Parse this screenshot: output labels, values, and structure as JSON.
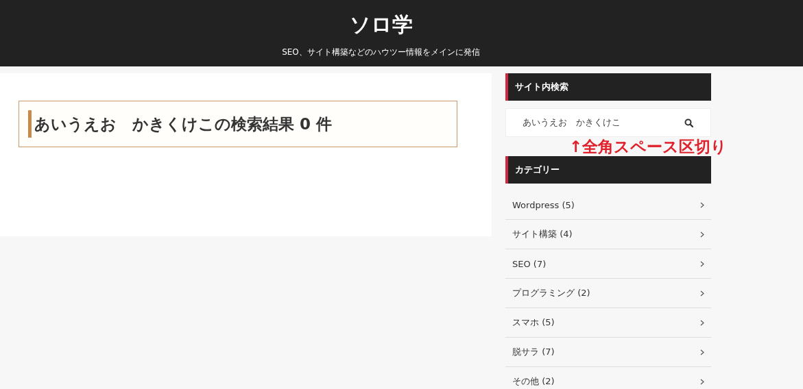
{
  "header": {
    "site_title": "ソロ学",
    "tagline": "SEO、サイト構築などのハウツー情報をメインに発信"
  },
  "main": {
    "heading": "あいうえお　かきくけこの検索結果 0 件"
  },
  "sidebar": {
    "search_widget": {
      "title": "サイト内検索",
      "value": "あいうえお　かきくけこ"
    },
    "annotation": "↑全角スペース区切り",
    "category_widget": {
      "title": "カテゴリー",
      "items": [
        {
          "label": "Wordpress (5)"
        },
        {
          "label": "サイト構築 (4)"
        },
        {
          "label": "SEO (7)"
        },
        {
          "label": "プログラミング (2)"
        },
        {
          "label": "スマホ (5)"
        },
        {
          "label": "脱サラ (7)"
        },
        {
          "label": "その他 (2)"
        }
      ]
    }
  }
}
